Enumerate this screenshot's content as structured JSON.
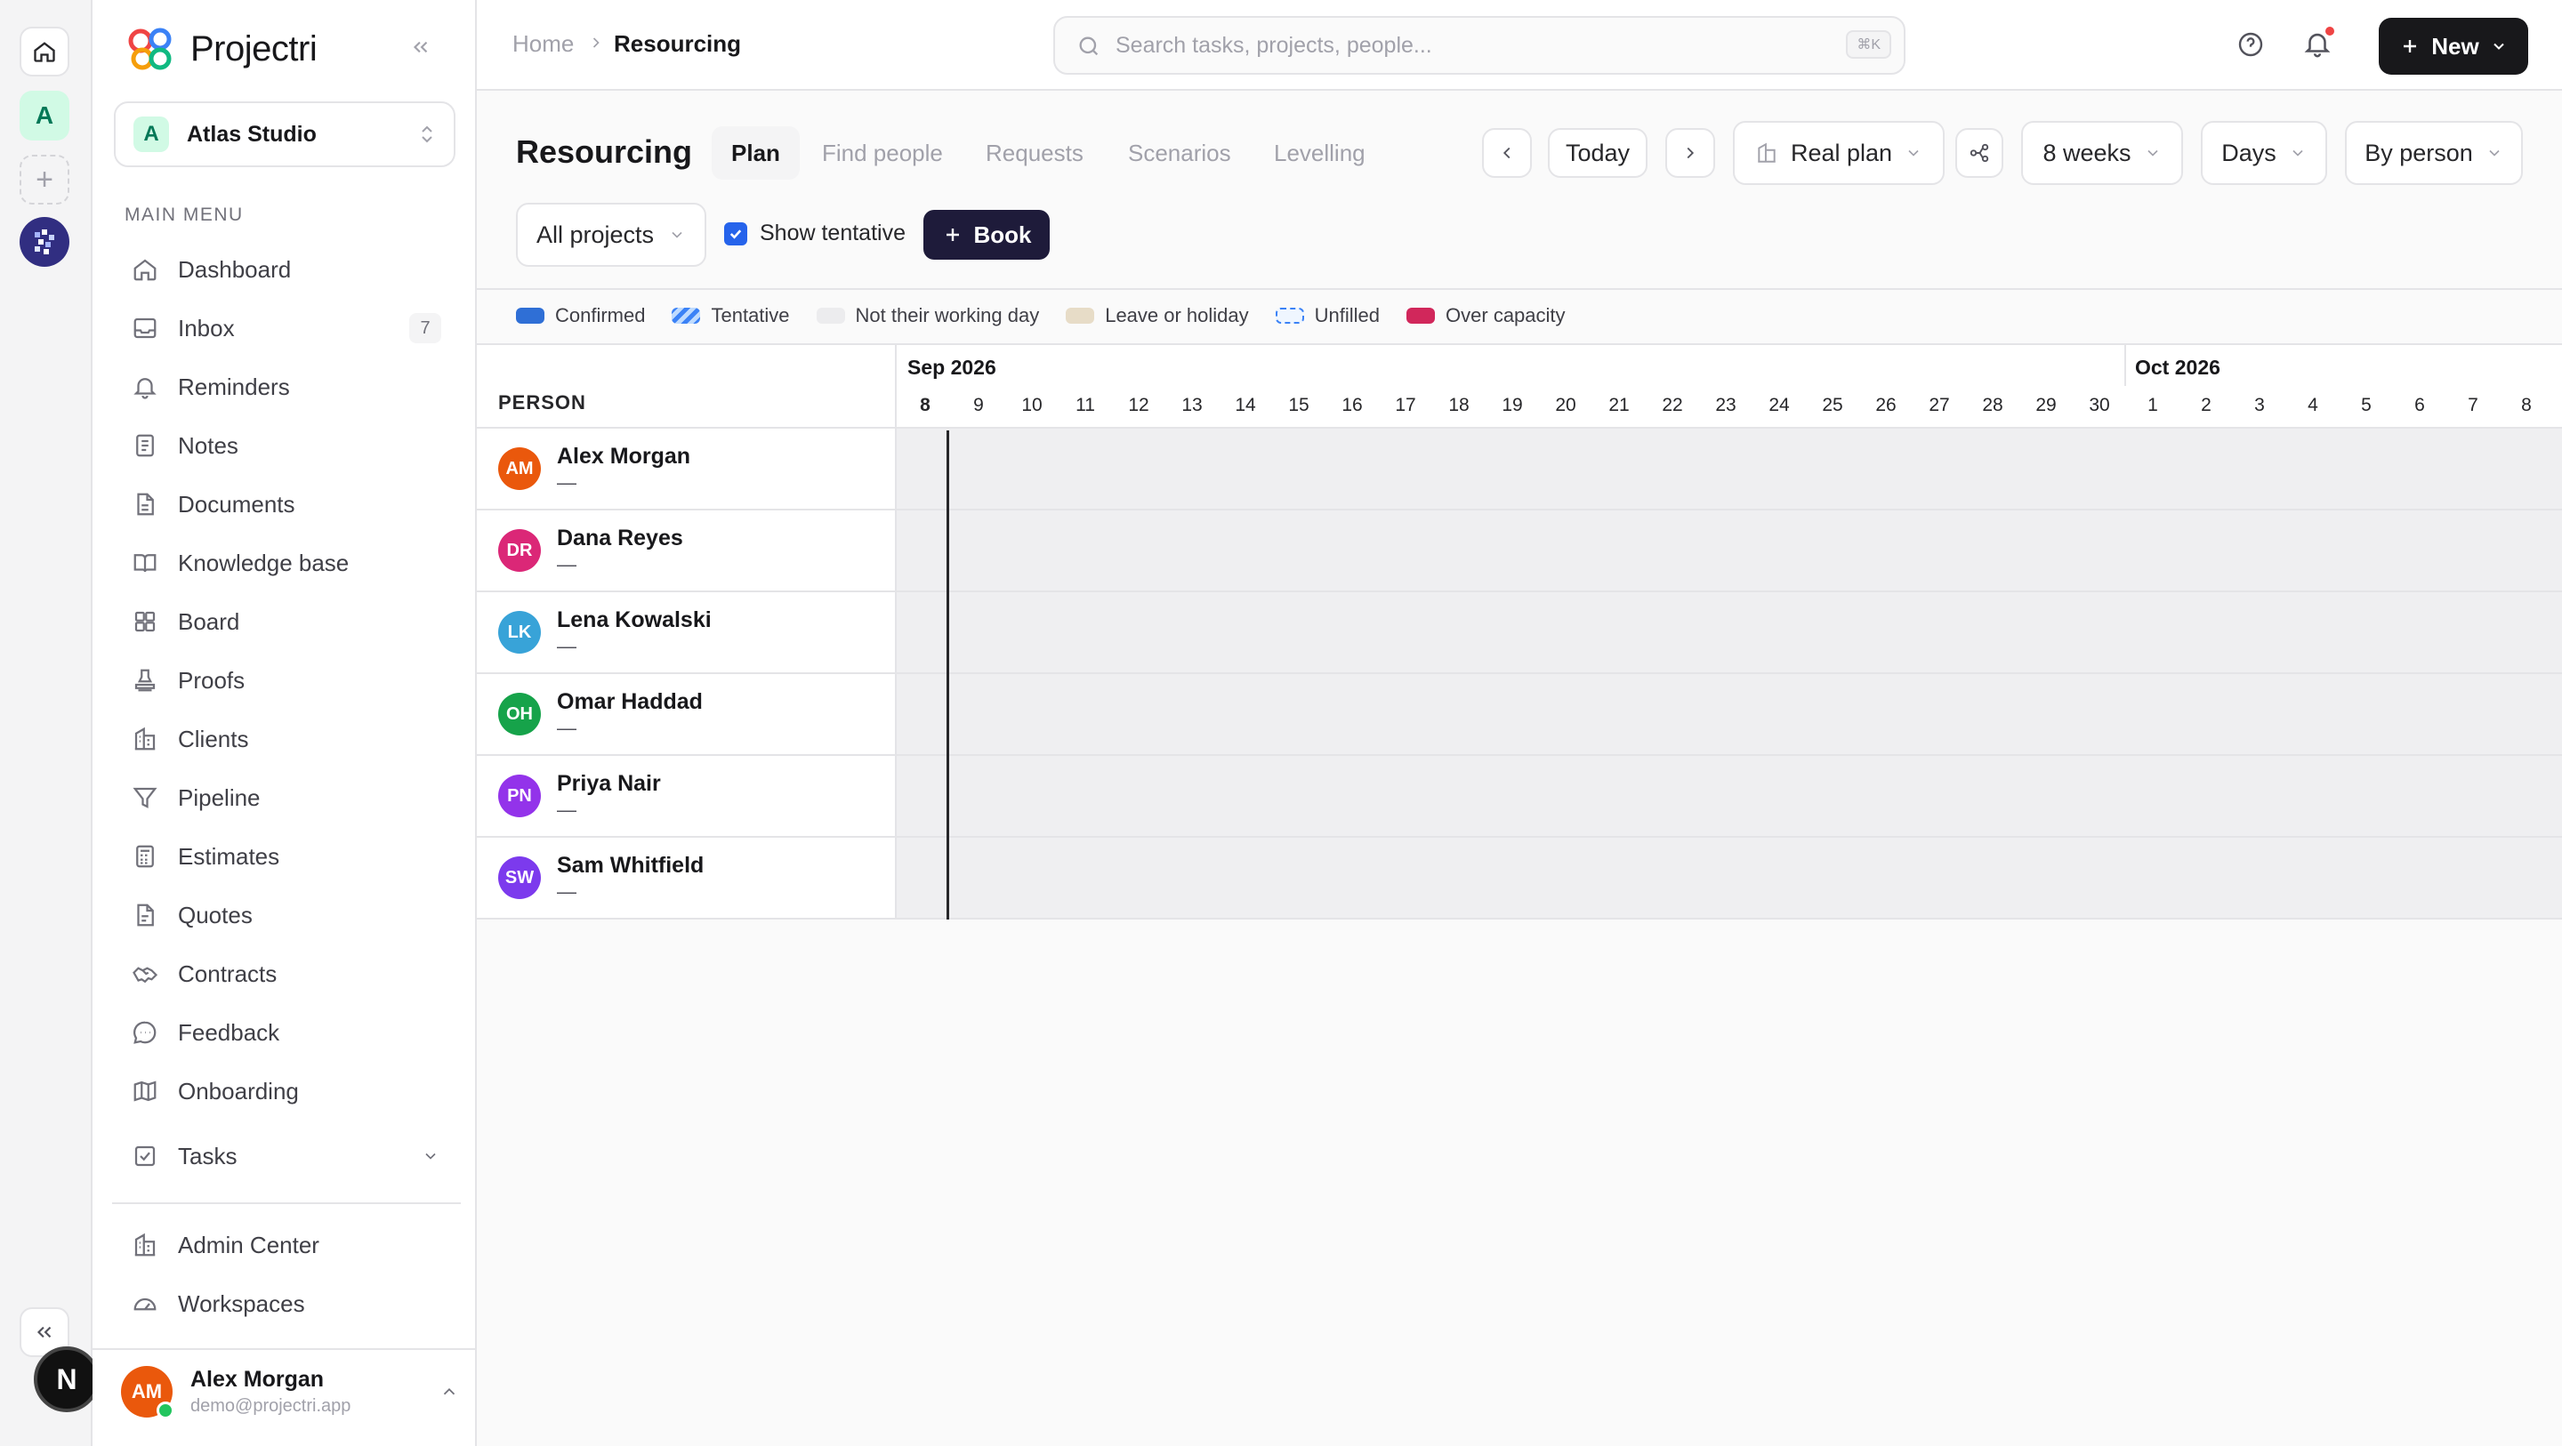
{
  "app": {
    "name": "Projectri"
  },
  "workspace": {
    "badge": "A",
    "name": "Atlas Studio",
    "rail_badge": "A",
    "rail_n": "N"
  },
  "sidebar": {
    "menu_title": "MAIN MENU",
    "items": [
      {
        "label": "Dashboard",
        "icon": "home-icon"
      },
      {
        "label": "Inbox",
        "icon": "inbox-icon",
        "badge": "7"
      },
      {
        "label": "Reminders",
        "icon": "bell-icon"
      },
      {
        "label": "Notes",
        "icon": "note-icon"
      },
      {
        "label": "Documents",
        "icon": "document-icon"
      },
      {
        "label": "Knowledge base",
        "icon": "book-icon"
      },
      {
        "label": "Board",
        "icon": "board-icon"
      },
      {
        "label": "Proofs",
        "icon": "stamp-icon"
      },
      {
        "label": "Clients",
        "icon": "building-icon"
      },
      {
        "label": "Pipeline",
        "icon": "funnel-icon"
      },
      {
        "label": "Estimates",
        "icon": "calculator-icon"
      },
      {
        "label": "Quotes",
        "icon": "quote-doc-icon"
      },
      {
        "label": "Contracts",
        "icon": "handshake-icon"
      },
      {
        "label": "Feedback",
        "icon": "chat-icon"
      },
      {
        "label": "Onboarding",
        "icon": "map-icon"
      },
      {
        "label": "Tasks",
        "icon": "checkbox-icon"
      }
    ],
    "bottom_items": [
      {
        "label": "Admin Center",
        "icon": "building-icon"
      },
      {
        "label": "Workspaces",
        "icon": "gauge-icon"
      }
    ],
    "user": {
      "initials": "AM",
      "name": "Alex Morgan",
      "email": "demo@projectri.app"
    }
  },
  "topbar": {
    "breadcrumb": {
      "home": "Home",
      "current": "Resourcing"
    },
    "search_placeholder": "Search tasks, projects, people...",
    "search_shortcut": "⌘K",
    "new_label": "New"
  },
  "page": {
    "title": "Resourcing",
    "tabs": [
      "Plan",
      "Find people",
      "Requests",
      "Scenarios",
      "Levelling"
    ],
    "active_tab": "Plan",
    "today_label": "Today",
    "plan_select": "Real plan",
    "range_select": "8 weeks",
    "unit_select": "Days",
    "group_select": "By person",
    "project_filter": "All projects",
    "show_tentative_label": "Show tentative",
    "show_tentative": true,
    "book_label": "Book"
  },
  "legend": [
    {
      "label": "Confirmed",
      "color": "#2f6fd6"
    },
    {
      "label": "Tentative",
      "color": "#3b82f6"
    },
    {
      "label": "Not their working day",
      "color": "#ececee"
    },
    {
      "label": "Leave or holiday",
      "color": "#e7dcc7"
    },
    {
      "label": "Unfilled",
      "color": "#3b82f6"
    },
    {
      "label": "Over capacity",
      "color": "#d1275b"
    }
  ],
  "timeline": {
    "person_header": "PERSON",
    "months": [
      "Sep 2026",
      "Oct 2026"
    ],
    "days": [
      "8",
      "9",
      "10",
      "11",
      "12",
      "13",
      "14",
      "15",
      "16",
      "17",
      "18",
      "19",
      "20",
      "21",
      "22",
      "23",
      "24",
      "25",
      "26",
      "27",
      "28",
      "29",
      "30",
      "1",
      "2",
      "3",
      "4",
      "5",
      "6",
      "7",
      "8"
    ],
    "today_day": "8",
    "people": [
      {
        "initials": "AM",
        "name": "Alex Morgan",
        "role": "—",
        "color": "#ea580c"
      },
      {
        "initials": "DR",
        "name": "Dana Reyes",
        "role": "—",
        "color": "#db2777"
      },
      {
        "initials": "LK",
        "name": "Lena Kowalski",
        "role": "—",
        "color": "#38a3d8"
      },
      {
        "initials": "OH",
        "name": "Omar Haddad",
        "role": "—",
        "color": "#16a34a"
      },
      {
        "initials": "PN",
        "name": "Priya Nair",
        "role": "—",
        "color": "#9333ea"
      },
      {
        "initials": "SW",
        "name": "Sam Whitfield",
        "role": "—",
        "color": "#7c3aed"
      }
    ]
  }
}
